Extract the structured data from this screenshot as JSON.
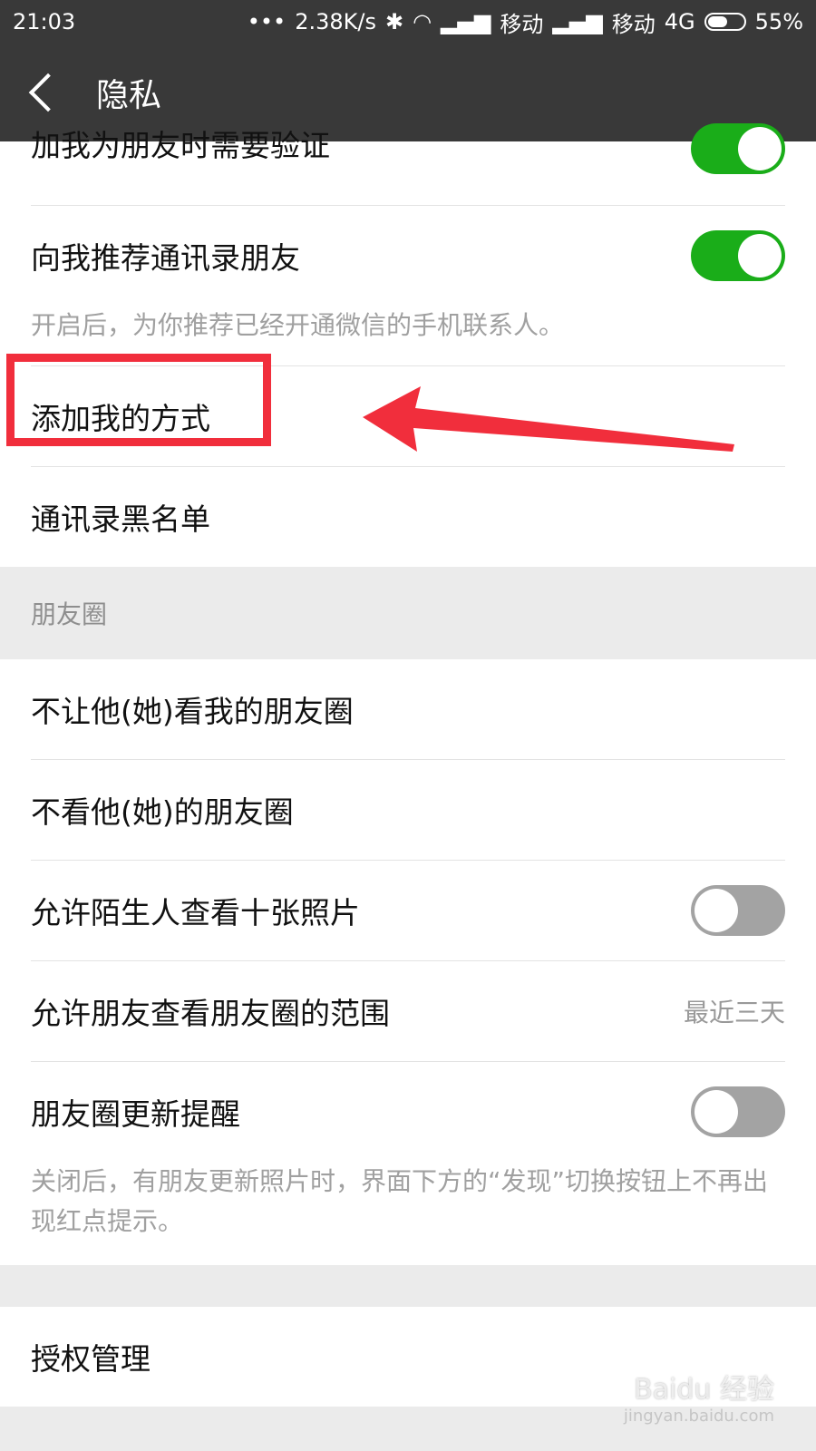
{
  "status_bar": {
    "time": "21:03",
    "dots": "•••",
    "speed": "2.38K/s",
    "carrier1": "移动",
    "carrier2": "移动",
    "network": "4G",
    "battery": "55%",
    "battery_level": 0.55
  },
  "header": {
    "title": "隐私"
  },
  "friends_section": {
    "items": [
      {
        "label": "加我为朋友时需要验证",
        "toggle": "on"
      },
      {
        "label": "向我推荐通讯录朋友",
        "toggle": "on"
      }
    ],
    "recommend_hint": "开启后，为你推荐已经开通微信的手机联系人。",
    "add_methods": "添加我的方式",
    "blacklist": "通讯录黑名单"
  },
  "moments_section": {
    "title": "朋友圈",
    "hide_my_moments": "不让他(她)看我的朋友圈",
    "hide_their_moments": "不看他(她)的朋友圈",
    "allow_strangers": "允许陌生人查看十张照片",
    "allow_strangers_toggle": "off",
    "view_range_label": "允许朋友查看朋友圈的范围",
    "view_range_value": "最近三天",
    "update_reminder": "朋友圈更新提醒",
    "update_reminder_toggle": "off",
    "update_hint": "关闭后，有朋友更新照片时，界面下方的“发现”切换按钮上不再出现红点提示。"
  },
  "auth": {
    "label": "授权管理"
  },
  "watermark": {
    "brand": "Baidu 经验",
    "url": "jingyan.baidu.com"
  },
  "colors": {
    "toggle_on": "#1aad19",
    "toggle_off": "#a3a3a3",
    "annotation": "#f12e3c",
    "header_bg": "#393939"
  }
}
